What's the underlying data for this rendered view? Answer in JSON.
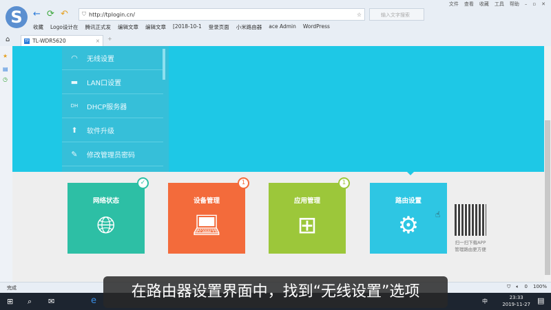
{
  "browser": {
    "menu": [
      "文件",
      "查看",
      "收藏",
      "工具",
      "帮助"
    ],
    "url": "http://tplogin.cn/",
    "search_placeholder": "输入文字搜索",
    "bookmarks": [
      "收藏",
      "Logo设计在",
      "腾讯正式发",
      "编辑文章",
      "编辑文章",
      "[2018-10-1",
      "登录页面",
      "小米路由器",
      "ace Admin",
      "WordPress"
    ],
    "tab_title": "TL-WDR5620",
    "tab_icon": "TP",
    "status": "完成",
    "zoom": "100%",
    "badge_count": "0"
  },
  "router": {
    "menu": [
      {
        "icon": "wifi-icon",
        "label": "无线设置"
      },
      {
        "icon": "lan-icon",
        "label": "LAN口设置"
      },
      {
        "icon": "dhcp-icon",
        "label": "DHCP服务器"
      },
      {
        "icon": "upgrade-icon",
        "label": "软件升级"
      },
      {
        "icon": "pencil-icon",
        "label": "修改管理员密码"
      }
    ],
    "tiles": [
      {
        "label": "网络状态",
        "color": "#2dbfa5",
        "badge": "✓"
      },
      {
        "label": "设备管理",
        "color": "#f36b3b",
        "badge": "1"
      },
      {
        "label": "应用管理",
        "color": "#9cc73a",
        "badge": "1"
      },
      {
        "label": "路由设置",
        "color": "#2ec6e3",
        "badge": ""
      }
    ],
    "qr_text": [
      "扫一扫下载APP",
      "管理路由更方便"
    ]
  },
  "taskbar": {
    "time": "23:33",
    "date": "2019-11-27",
    "ime": "中"
  },
  "subtitle": "在路由器设置界面中，找到“无线设置”选项"
}
